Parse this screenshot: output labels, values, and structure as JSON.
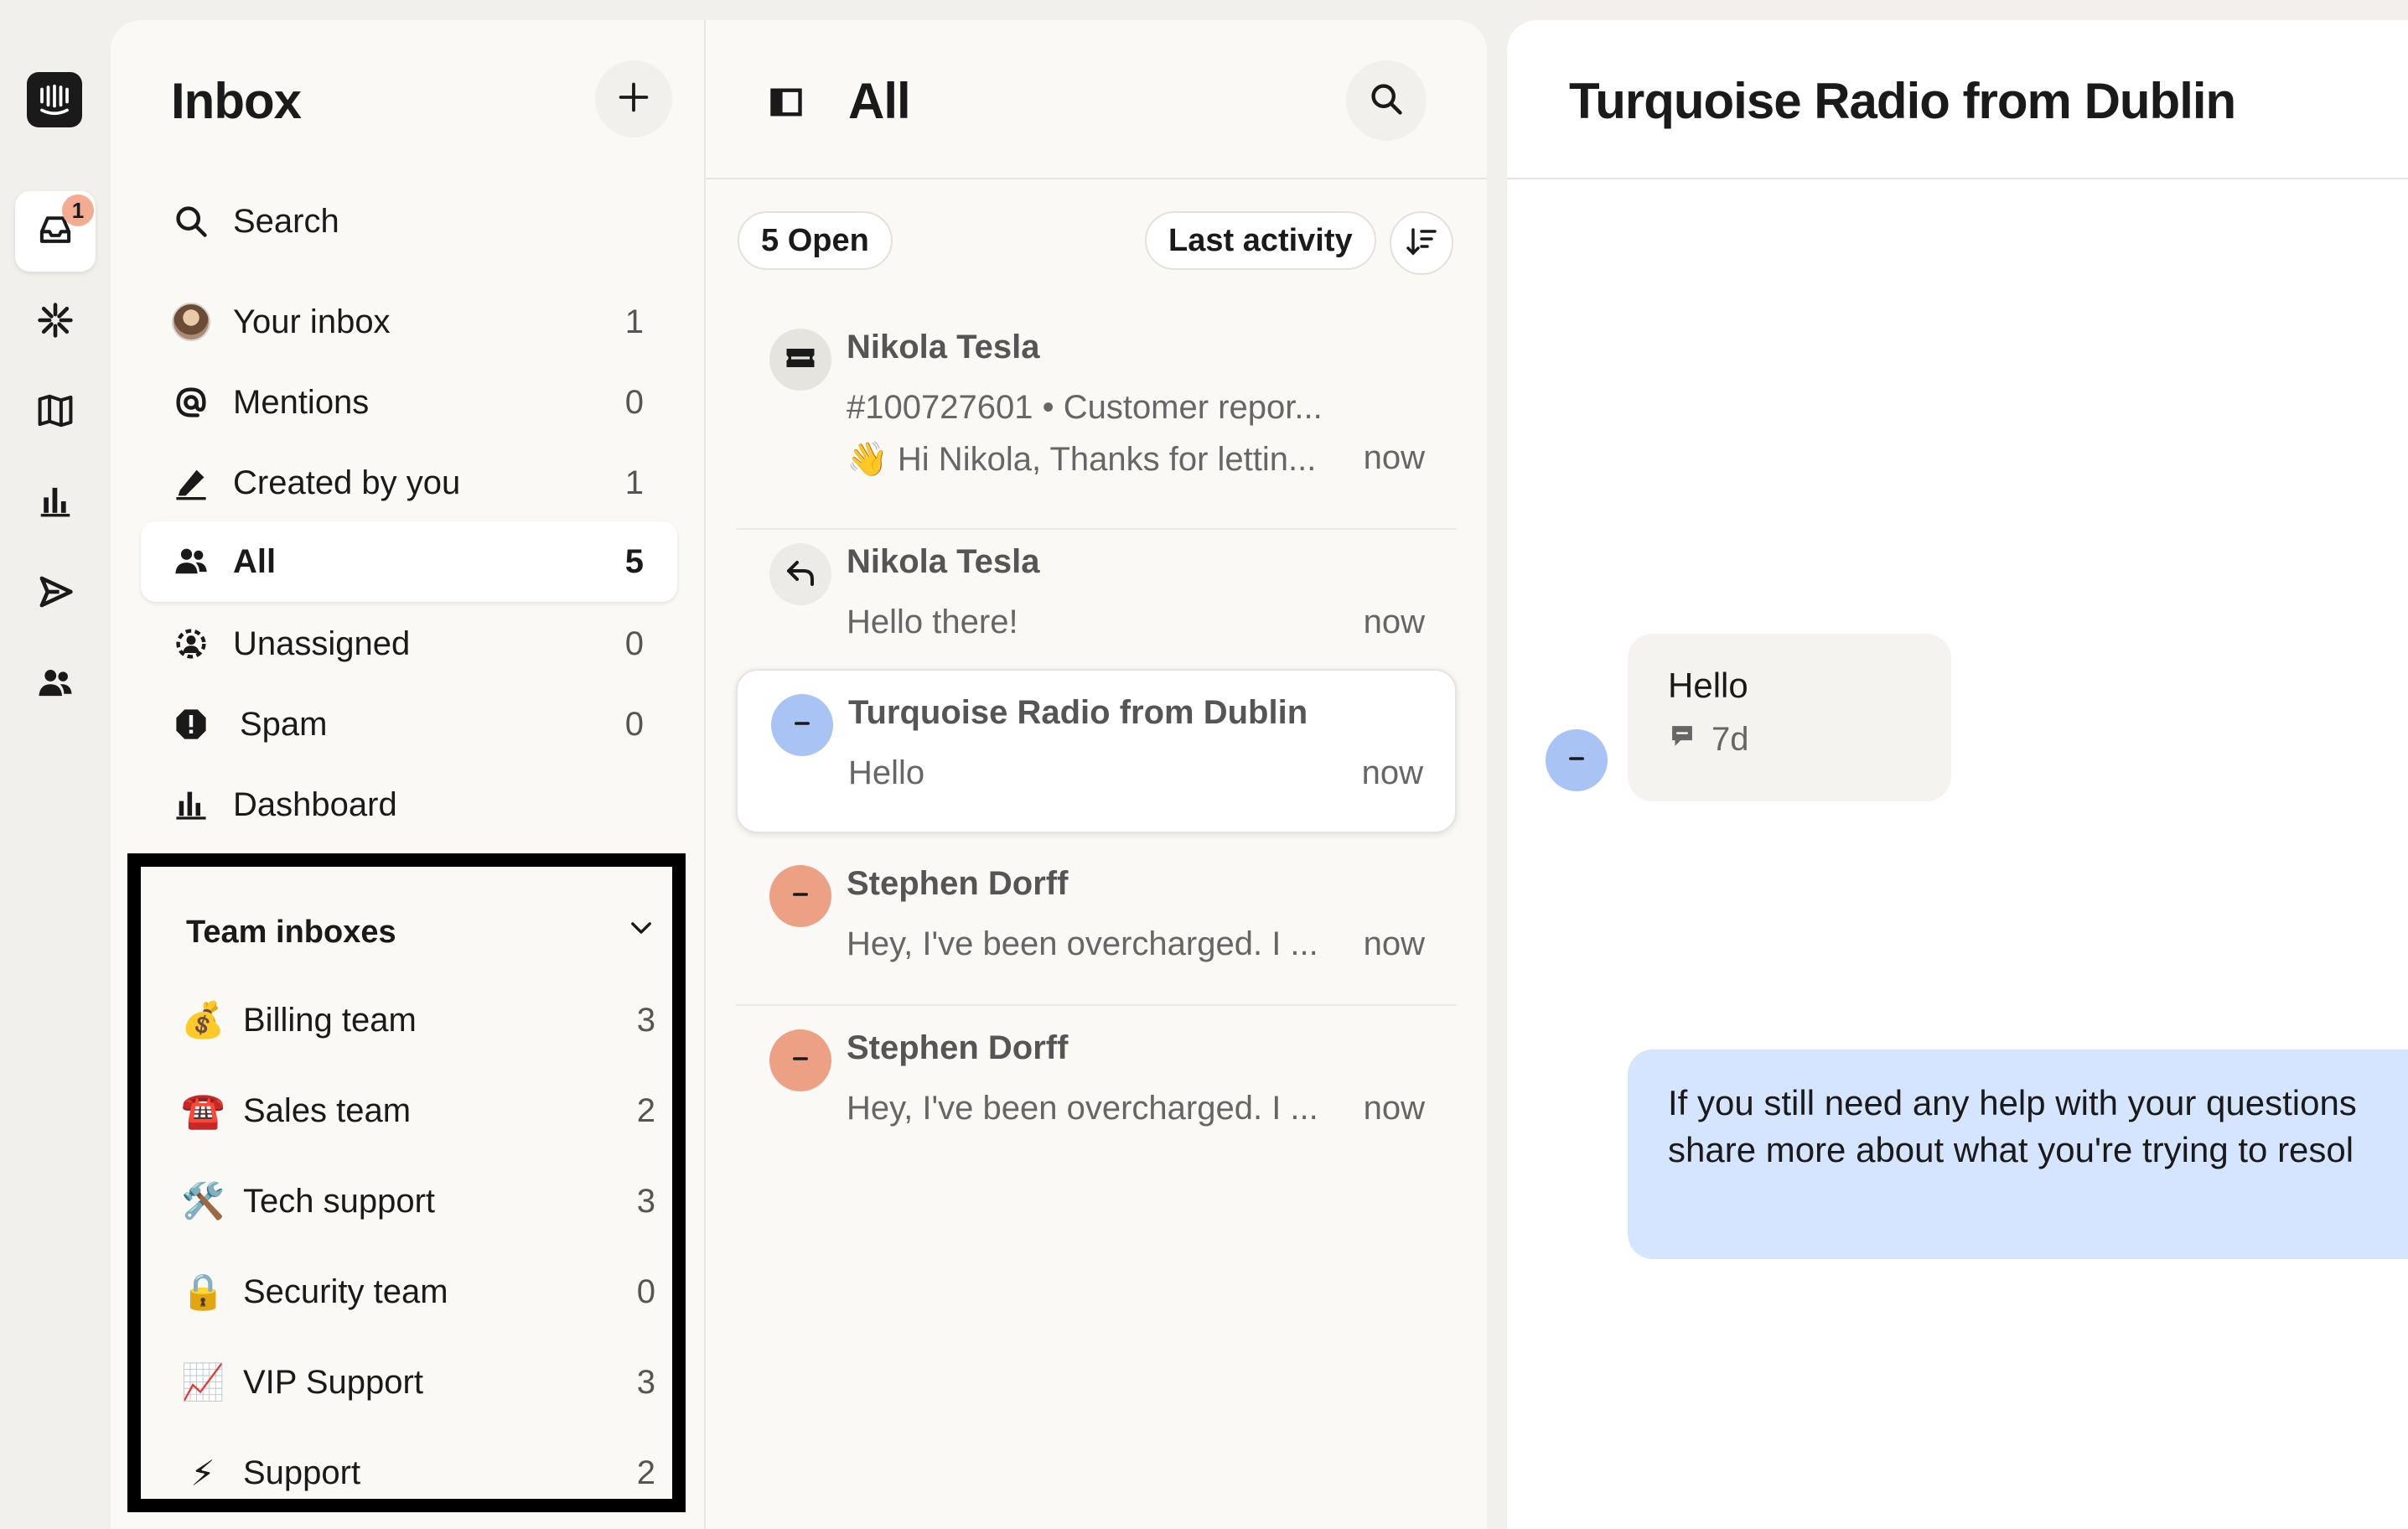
{
  "rail": {
    "items": [
      {
        "name": "inbox-icon",
        "badge": "1",
        "active": true
      },
      {
        "name": "fin-icon"
      },
      {
        "name": "knowledge-icon"
      },
      {
        "name": "reports-icon"
      },
      {
        "name": "outbound-icon"
      },
      {
        "name": "contacts-icon"
      }
    ]
  },
  "sidebar": {
    "title": "Inbox",
    "search_label": "Search",
    "items": [
      {
        "label": "Your inbox",
        "count": "1"
      },
      {
        "label": "Mentions",
        "count": "0"
      },
      {
        "label": "Created by you",
        "count": "1"
      },
      {
        "label": "All",
        "count": "5",
        "active": true
      },
      {
        "label": "Unassigned",
        "count": "0"
      },
      {
        "label": "Spam",
        "count": "0"
      },
      {
        "label": "Dashboard",
        "count": ""
      }
    ],
    "team_header": "Team inboxes",
    "teams": [
      {
        "emoji": "💰",
        "label": "Billing team",
        "count": "3"
      },
      {
        "emoji": "☎️",
        "label": "Sales team",
        "count": "2"
      },
      {
        "emoji": "🛠️",
        "label": "Tech support",
        "count": "3"
      },
      {
        "emoji": "🔒",
        "label": "Security team",
        "count": "0"
      },
      {
        "emoji": "📈",
        "label": "VIP Support",
        "count": "3"
      },
      {
        "emoji": "⚡",
        "label": "Support",
        "count": "2"
      }
    ]
  },
  "list": {
    "title": "All",
    "filter": "5 Open",
    "sort": "Last activity",
    "conversations": [
      {
        "name": "Nikola Tesla",
        "line1": "#100727601 • Customer repor...",
        "line2": "👋 Hi Nikola, Thanks for lettin...",
        "time": "now"
      },
      {
        "name": "Nikola Tesla",
        "line2": "Hello there!",
        "time": "now"
      },
      {
        "name": "Turquoise Radio from Dublin",
        "line2": "Hello",
        "time": "now"
      },
      {
        "name": "Stephen Dorff",
        "line2": "Hey, I've been overcharged. I ...",
        "time": "now"
      },
      {
        "name": "Stephen Dorff",
        "line2": "Hey, I've been overcharged. I ...",
        "time": "now"
      }
    ]
  },
  "detail": {
    "title": "Turquoise Radio from Dublin",
    "incoming": {
      "text": "Hello",
      "meta": "7d"
    },
    "outgoing": {
      "line1": "If you still need any help with your questions",
      "line2": "share more about what you're trying to resol"
    }
  },
  "colors": {
    "background": "#f1f0ec",
    "panel": "#faf9f6",
    "badge": "#f3ab91",
    "avatar_blue": "#a9c3f4",
    "avatar_orange": "#eda184",
    "outgoing_bubble": "#d6e5ff"
  }
}
